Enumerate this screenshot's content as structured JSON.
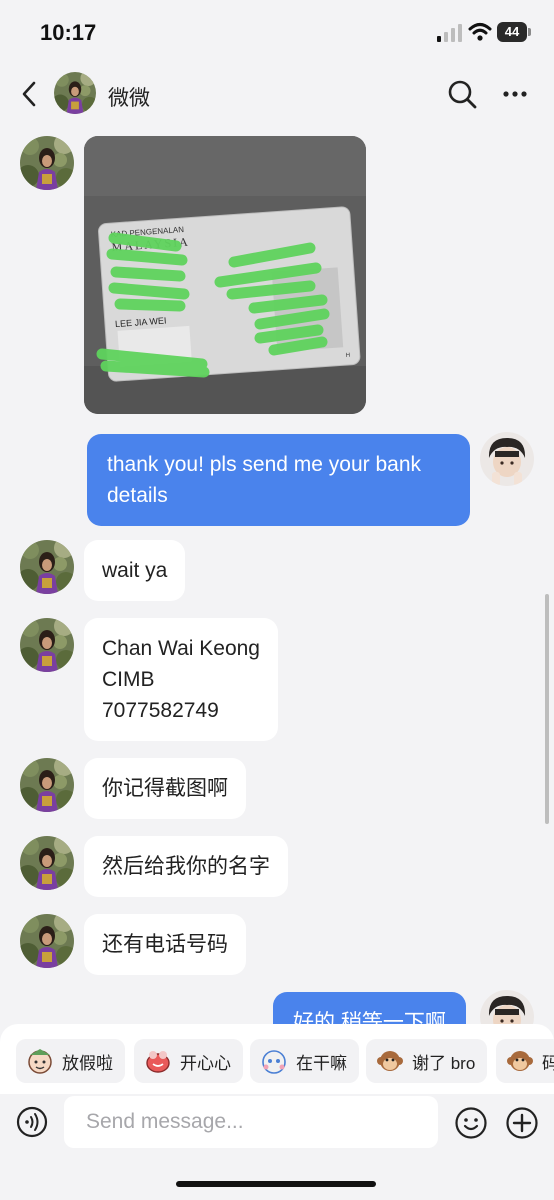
{
  "status_bar": {
    "time": "10:17",
    "battery": "44",
    "icons": [
      "signal-icon",
      "wifi-icon",
      "battery-icon"
    ]
  },
  "header": {
    "contact_name": "微微",
    "icons": [
      "back-icon",
      "search-icon",
      "more-icon"
    ]
  },
  "card_photo": {
    "title_line1": "KAD PENGENALAN",
    "title_line2": "MALAYSIA",
    "name": "LEE JIA WEI",
    "corner_mark": "H"
  },
  "messages": [
    {
      "id": "m0",
      "side": "received",
      "type": "image"
    },
    {
      "id": "m1",
      "side": "sent",
      "lines": [
        "thank you! pls send me your bank",
        "details"
      ]
    },
    {
      "id": "m2",
      "side": "received",
      "lines": [
        "wait ya"
      ]
    },
    {
      "id": "m3",
      "side": "received",
      "lines": [
        "Chan Wai Keong",
        "CIMB",
        "7077582749"
      ]
    },
    {
      "id": "m4",
      "side": "received",
      "lines": [
        "你记得截图啊"
      ]
    },
    {
      "id": "m5",
      "side": "received",
      "lines": [
        "然后给我你的名字"
      ]
    },
    {
      "id": "m6",
      "side": "received",
      "lines": [
        "还有电话号码"
      ]
    },
    {
      "id": "m7",
      "side": "sent",
      "lines": [
        "好的 稍等一下啊"
      ]
    }
  ],
  "quick_replies": [
    {
      "label": "放假啦",
      "icon": "sticker-vacation-icon"
    },
    {
      "label": "开心心",
      "icon": "sticker-happy-icon"
    },
    {
      "label": "在干嘛",
      "icon": "sticker-what-doing-icon"
    },
    {
      "label": "谢了 bro",
      "icon": "sticker-monkey-thanks-icon"
    },
    {
      "label": "码",
      "icon": "sticker-monkey-icon"
    }
  ],
  "input": {
    "placeholder": "Send message...",
    "value": ""
  },
  "colors": {
    "background": "#f3f3f5",
    "sent_bubble": "#4a83ec",
    "received_bubble": "#ffffff"
  }
}
